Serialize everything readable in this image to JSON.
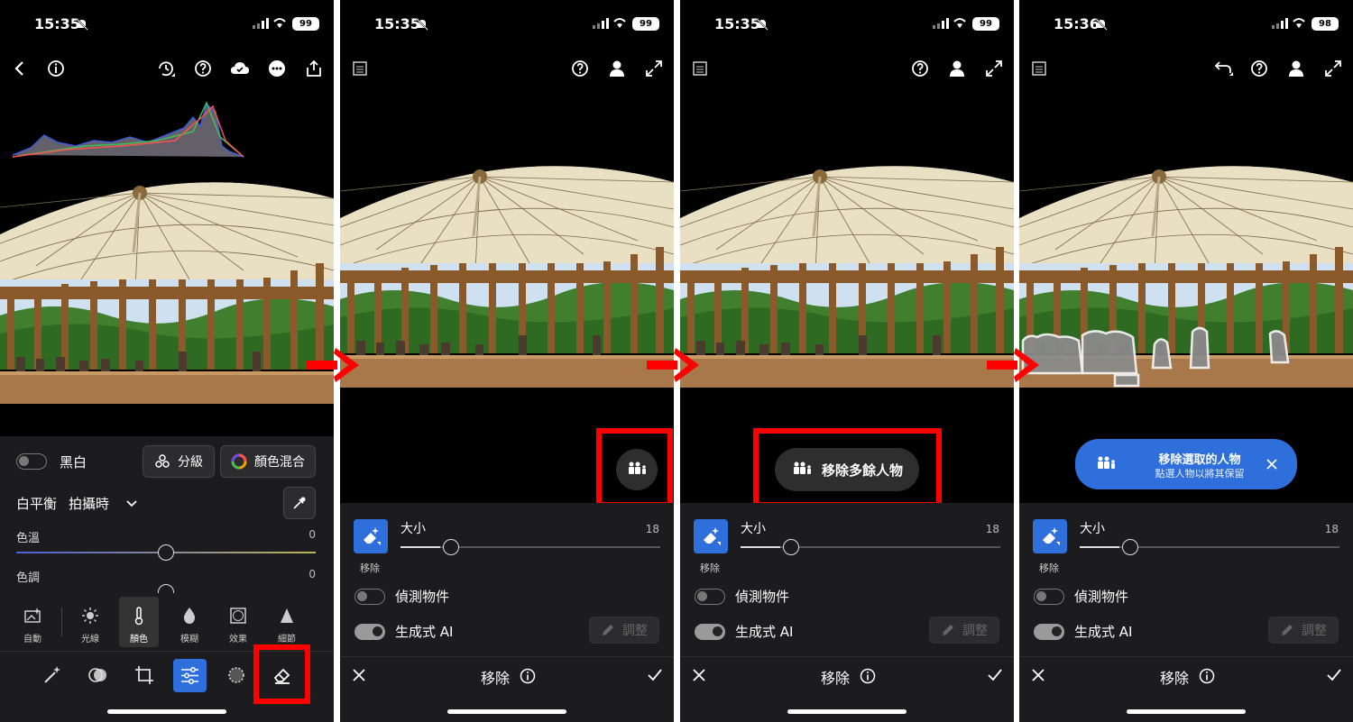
{
  "screens": [
    {
      "status": {
        "time": "15:35",
        "battery": "99"
      },
      "panel": {
        "bw_label": "黑白",
        "grading_button": "分級",
        "color_mix_button": "顏色混合",
        "white_balance_label": "白平衡",
        "white_balance_value": "拍攝時",
        "temp_label": "色溫",
        "temp_value": "0",
        "tint_label": "色調",
        "tint_value": "0"
      },
      "tools": [
        "自動",
        "光線",
        "顏色",
        "模糊",
        "效果",
        "細節"
      ]
    },
    {
      "status": {
        "time": "15:35",
        "battery": "99"
      },
      "remove": {
        "size_label": "大小",
        "size_value": "18",
        "tool_label": "移除",
        "detect_label": "偵測物件",
        "gen_ai_label": "生成式 AI",
        "adjust_button": "調整",
        "title": "移除"
      }
    },
    {
      "status": {
        "time": "15:35",
        "battery": "99"
      },
      "remove": {
        "size_label": "大小",
        "size_value": "18",
        "tool_label": "移除",
        "detect_label": "偵測物件",
        "gen_ai_label": "生成式 AI",
        "adjust_button": "調整",
        "title": "移除"
      },
      "pill_label": "移除多餘人物"
    },
    {
      "status": {
        "time": "15:36",
        "battery": "98"
      },
      "remove": {
        "size_label": "大小",
        "size_value": "18",
        "tool_label": "移除",
        "detect_label": "偵測物件",
        "gen_ai_label": "生成式 AI",
        "adjust_button": "調整",
        "title": "移除"
      },
      "banner_title": "移除選取的人物",
      "banner_subtitle": "點選人物以將其保留"
    }
  ],
  "colors": {
    "accent_blue": "#2e6fdc",
    "highlight_red": "#ff0000",
    "panel": "#1c1c1e"
  }
}
